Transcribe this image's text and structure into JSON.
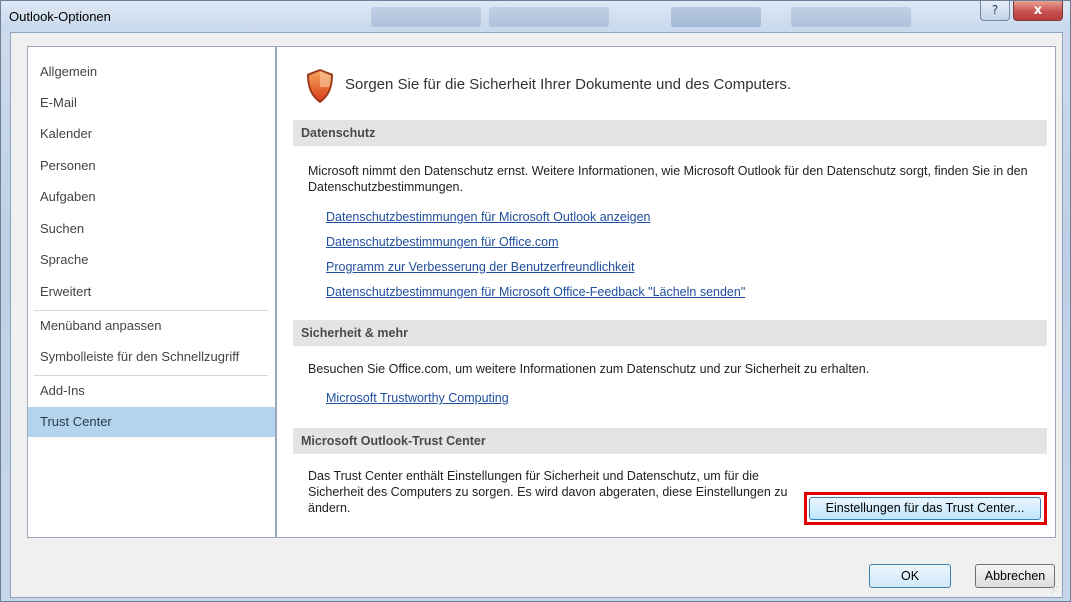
{
  "window": {
    "title": "Outlook-Optionen",
    "help_label": "?",
    "close_label": "x"
  },
  "sidebar": {
    "items": [
      {
        "label": "Allgemein"
      },
      {
        "label": "E-Mail"
      },
      {
        "label": "Kalender"
      },
      {
        "label": "Personen"
      },
      {
        "label": "Aufgaben"
      },
      {
        "label": "Suchen"
      },
      {
        "label": "Sprache"
      },
      {
        "label": "Erweitert"
      },
      {
        "label": "Menüband anpassen"
      },
      {
        "label": "Symbolleiste für den Schnellzugriff"
      },
      {
        "label": "Add-Ins"
      },
      {
        "label": "Trust Center"
      }
    ],
    "selected": "Trust Center"
  },
  "main": {
    "headline": "Sorgen Sie für die Sicherheit Ihrer Dokumente und des Computers.",
    "icon": "shield-icon",
    "sections": [
      {
        "title": "Datenschutz",
        "text": "Microsoft nimmt den Datenschutz ernst. Weitere Informationen, wie Microsoft Outlook für den Datenschutz sorgt, finden Sie in den Datenschutzbestimmungen.",
        "links": [
          "Datenschutzbestimmungen für Microsoft Outlook anzeigen",
          "Datenschutzbestimmungen für Office.com",
          "Programm zur Verbesserung der Benutzerfreundlichkeit",
          "Datenschutzbestimmungen für Microsoft Office-Feedback \"Lächeln senden\""
        ]
      },
      {
        "title": "Sicherheit & mehr",
        "text": "Besuchen Sie Office.com, um weitere Informationen zum Datenschutz und zur Sicherheit zu erhalten.",
        "links": [
          "Microsoft Trustworthy Computing"
        ]
      },
      {
        "title": "Microsoft Outlook-Trust Center",
        "text": "Das Trust Center enthält Einstellungen für Sicherheit und Datenschutz, um für die Sicherheit des Computers zu sorgen. Es wird davon abgeraten, diese Einstellungen zu ändern.",
        "button_label": "Einstellungen für das Trust Center..."
      }
    ]
  },
  "footer": {
    "ok_label": "OK",
    "cancel_label": "Abbrechen"
  },
  "colors": {
    "selected_nav": "#b3d4ec",
    "link": "#1f4e9e",
    "highlight": "#e00000",
    "shield": "#e8531f"
  }
}
